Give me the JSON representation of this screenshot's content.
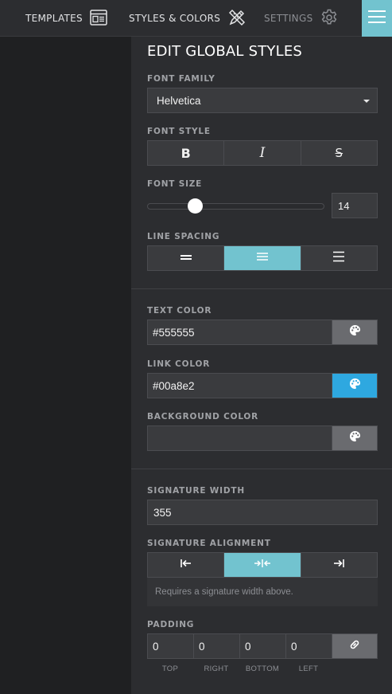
{
  "nav": {
    "templates_label": "TEMPLATES",
    "styles_label": "STYLES & COLORS",
    "settings_label": "SETTINGS",
    "templates_icon": "template-icon",
    "styles_icon": "pencil-ruler-icon",
    "settings_icon": "gear-icon",
    "menu_icon": "hamburger-menu-icon"
  },
  "panel": {
    "title": "EDIT GLOBAL STYLES",
    "font_family": {
      "label": "FONT FAMILY",
      "value": "Helvetica"
    },
    "font_style": {
      "label": "FONT STYLE",
      "bold": "B",
      "italic": "I",
      "strike": "S"
    },
    "font_size": {
      "label": "FONT SIZE",
      "value": "14",
      "slider_fraction": 0.27
    },
    "line_spacing": {
      "label": "LINE SPACING",
      "active": "normal"
    },
    "text_color": {
      "label": "TEXT COLOR",
      "value": "#555555",
      "button_color": "#6a6b6f"
    },
    "link_color": {
      "label": "LINK COLOR",
      "value": "#00a8e2",
      "button_color": "#2ea8e0"
    },
    "background_color": {
      "label": "BACKGROUND COLOR",
      "value": "",
      "button_color": "#6a6b6f"
    },
    "signature_width": {
      "label": "SIGNATURE WIDTH",
      "value": "355"
    },
    "signature_alignment": {
      "label": "SIGNATURE ALIGNMENT",
      "active": "center",
      "hint": "Requires a signature width above."
    },
    "padding": {
      "label": "PADDING",
      "top": "0",
      "right": "0",
      "bottom": "0",
      "left": "0",
      "top_label": "TOP",
      "right_label": "RIGHT",
      "bottom_label": "BOTTOM",
      "left_label": "LEFT"
    }
  },
  "colors": {
    "accent": "#72c3cf",
    "panel_bg": "#2c2d30",
    "field_bg": "#3a3b3e"
  }
}
